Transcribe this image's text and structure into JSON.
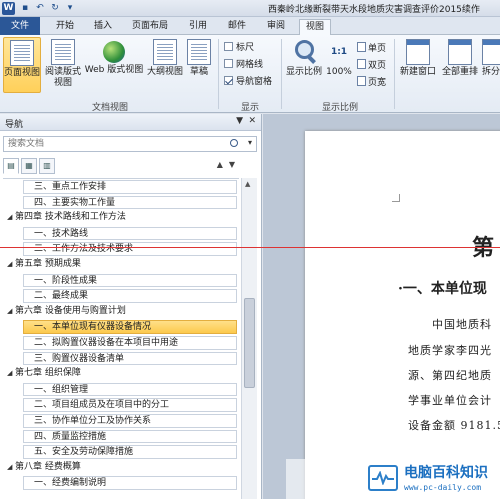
{
  "window": {
    "title": "西秦岭北缘断裂带天水段地质灾害调查评价2015续作"
  },
  "tabs": [
    {
      "label": "文件"
    },
    {
      "label": "开始"
    },
    {
      "label": "插入"
    },
    {
      "label": "页面布局"
    },
    {
      "label": "引用"
    },
    {
      "label": "邮件"
    },
    {
      "label": "审阅"
    },
    {
      "label": "视图"
    }
  ],
  "ribbon": {
    "views": {
      "print_layout": "页面视图",
      "reading": "阅读版式视图",
      "web": "Web 版式视图",
      "outline": "大纲视图",
      "draft": "草稿",
      "group": "文档视图"
    },
    "show": {
      "ruler": "标尺",
      "gridlines": "网格线",
      "nav_pane": "导航窗格",
      "group": "显示"
    },
    "zoom": {
      "zoom": "显示比例",
      "percent": "100%",
      "one_page": "单页",
      "two_pages": "双页",
      "page_width": "页宽",
      "group": "显示比例"
    },
    "window": {
      "new_window": "新建窗口",
      "arrange_all": "全部重排",
      "split": "拆分"
    }
  },
  "nav": {
    "title": "导航",
    "search_placeholder": "搜索文档",
    "tree": [
      {
        "type": "section",
        "text": "三、重点工作安排"
      },
      {
        "type": "section",
        "text": "四、主要实物工作量"
      },
      {
        "type": "chapter",
        "text": "第四章 技术路线和工作方法"
      },
      {
        "type": "section",
        "text": "一、技术路线"
      },
      {
        "type": "section",
        "text": "二、工作方法及技术要求"
      },
      {
        "type": "chapter",
        "text": "第五章 预期成果"
      },
      {
        "type": "section",
        "text": "一、阶段性成果"
      },
      {
        "type": "section",
        "text": "二、最终成果"
      },
      {
        "type": "chapter",
        "text": "第六章 设备使用与购置计划"
      },
      {
        "type": "section",
        "text": "一、本单位现有仪器设备情况",
        "selected": true
      },
      {
        "type": "section",
        "text": "二、拟购置仪器设备在本项目中用途"
      },
      {
        "type": "section",
        "text": "三、购置仪器设备清单"
      },
      {
        "type": "chapter",
        "text": "第七章 组织保障"
      },
      {
        "type": "section",
        "text": "一、组织管理"
      },
      {
        "type": "section",
        "text": "二、项目组成员及在项目中的分工"
      },
      {
        "type": "section",
        "text": "三、协作单位分工及协作关系"
      },
      {
        "type": "section",
        "text": "四、质量监控措施"
      },
      {
        "type": "section",
        "text": "五、安全及劳动保障措施"
      },
      {
        "type": "chapter",
        "text": "第八章 经费概算"
      },
      {
        "type": "section",
        "text": "一、经费编制说明"
      }
    ]
  },
  "document": {
    "chapter_title": "第",
    "section_title": "·一、本单位现",
    "lines": [
      "中国地质科",
      "地质学家李四光",
      "源、第四纪地质",
      "学事业单位会计",
      "设备金额 9181.5"
    ]
  },
  "watermark": {
    "name": "电脑百科知识",
    "url": "www.pc-daily.com"
  }
}
